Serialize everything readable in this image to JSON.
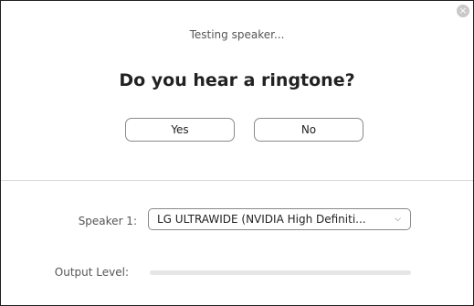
{
  "dialog": {
    "close_icon": "close-icon",
    "status_text": "Testing speaker...",
    "question": "Do you hear a ringtone?",
    "yes_label": "Yes",
    "no_label": "No"
  },
  "speaker": {
    "label": "Speaker 1:",
    "selected": "LG ULTRAWIDE (NVIDIA High Definiti...",
    "dropdown_icon": "chevron-down-icon"
  },
  "output": {
    "label": "Output Level:",
    "level_percent": 0
  },
  "colors": {
    "border": "#1f1f1f",
    "button_border": "#8a8a8a",
    "divider": "#d7d7d7",
    "level_track": "#e6e6e6"
  }
}
